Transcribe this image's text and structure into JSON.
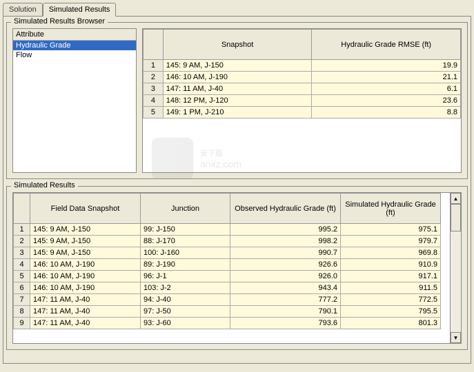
{
  "tabs": {
    "solution": "Solution",
    "simulated": "Simulated Results"
  },
  "browser": {
    "title": "Simulated Results Browser",
    "attr_header": "Attribute",
    "items": [
      "Hydraulic Grade",
      "Flow"
    ],
    "grid": {
      "col_snapshot": "Snapshot",
      "col_rmse": "Hydraulic Grade RMSE (ft)",
      "rows": [
        {
          "n": "1",
          "snap": "145: 9 AM, J-150",
          "rmse": "19.9"
        },
        {
          "n": "2",
          "snap": "146: 10 AM, J-190",
          "rmse": "21.1"
        },
        {
          "n": "3",
          "snap": "147: 11 AM, J-40",
          "rmse": "6.1"
        },
        {
          "n": "4",
          "snap": "148: 12 PM, J-120",
          "rmse": "23.6"
        },
        {
          "n": "5",
          "snap": "149: 1 PM, J-210",
          "rmse": "8.8"
        }
      ]
    }
  },
  "results": {
    "title": "Simulated Results",
    "cols": {
      "fds": "Field Data Snapshot",
      "jct": "Junction",
      "obs": "Observed Hydraulic Grade (ft)",
      "sim": "Simulated Hydraulic Grade (ft)"
    },
    "rows": [
      {
        "n": "1",
        "fds": "145: 9 AM, J-150",
        "jct": "99: J-150",
        "obs": "995.2",
        "sim": "975.1"
      },
      {
        "n": "2",
        "fds": "145: 9 AM, J-150",
        "jct": "88: J-170",
        "obs": "998.2",
        "sim": "979.7"
      },
      {
        "n": "3",
        "fds": "145: 9 AM, J-150",
        "jct": "100: J-160",
        "obs": "990.7",
        "sim": "969.8"
      },
      {
        "n": "4",
        "fds": "146: 10 AM, J-190",
        "jct": "89: J-190",
        "obs": "926.6",
        "sim": "910.9"
      },
      {
        "n": "5",
        "fds": "146: 10 AM, J-190",
        "jct": "96: J-1",
        "obs": "926.0",
        "sim": "917.1"
      },
      {
        "n": "6",
        "fds": "146: 10 AM, J-190",
        "jct": "103: J-2",
        "obs": "943.4",
        "sim": "911.5"
      },
      {
        "n": "7",
        "fds": "147: 11 AM, J-40",
        "jct": "94: J-40",
        "obs": "777.2",
        "sim": "772.5"
      },
      {
        "n": "8",
        "fds": "147: 11 AM, J-40",
        "jct": "97: J-50",
        "obs": "790.1",
        "sim": "795.5"
      },
      {
        "n": "9",
        "fds": "147: 11 AM, J-40",
        "jct": "93: J-60",
        "obs": "793.6",
        "sim": "801.3"
      }
    ]
  }
}
